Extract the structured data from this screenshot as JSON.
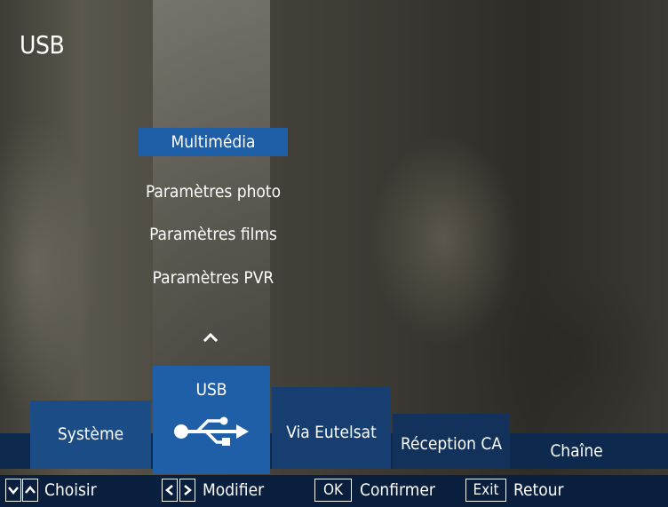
{
  "header": {
    "title": "USB"
  },
  "menu": {
    "items": [
      "Multimédia",
      "Paramètres photo",
      "Paramètres films",
      "Paramètres PVR"
    ],
    "selected_index": 0
  },
  "tiles": {
    "systeme": "Système",
    "usb": "USB",
    "via_eutelsat": "Via Eutelsat",
    "reception_ca": "Réception CA",
    "chaine": "Chaîne"
  },
  "footer": {
    "choisir": "Choisir",
    "modifier": "Modifier",
    "ok_key": "OK",
    "confirmer": "Confirmer",
    "exit_key": "Exit",
    "retour": "Retour"
  },
  "colors": {
    "accent": "#1f5fa8",
    "band": "#0d2a4e",
    "footer": "#0a1f3d"
  }
}
